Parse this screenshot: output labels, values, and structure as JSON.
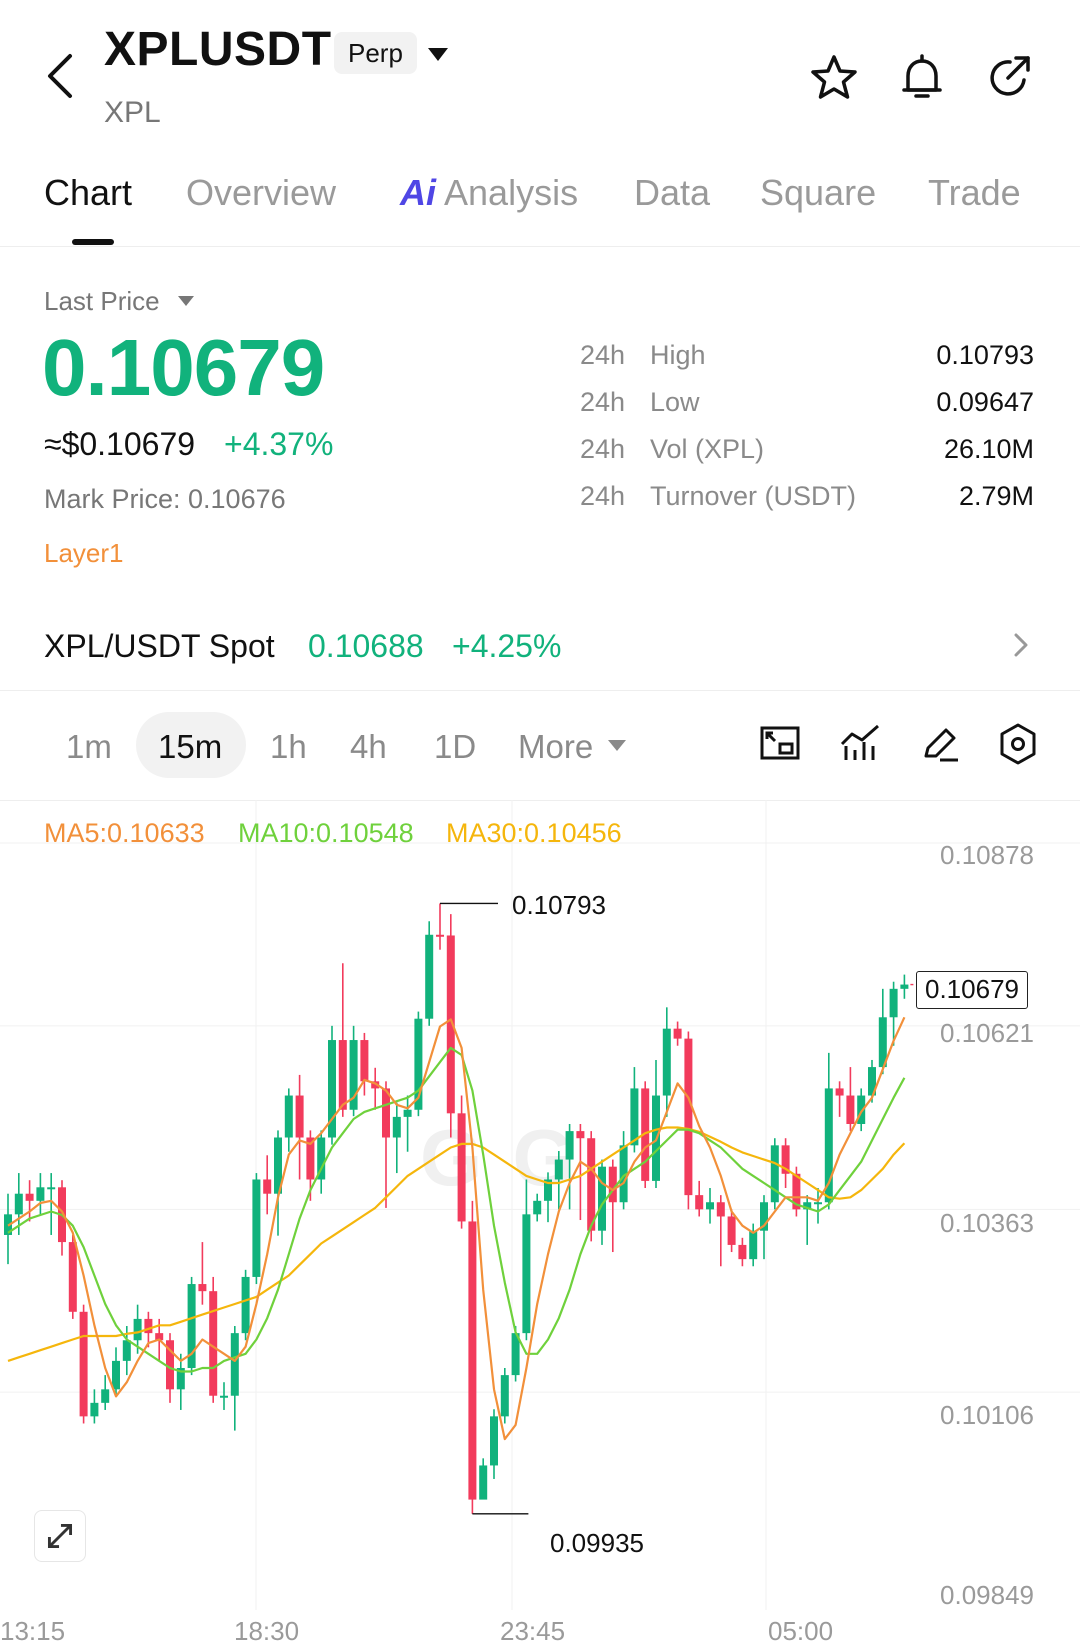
{
  "header": {
    "symbol": "XPLUSDT",
    "contract_type": "Perp",
    "base_asset": "XPL"
  },
  "icons": {
    "back": "chevron-left-icon",
    "favorite": "star-icon",
    "alert": "bell-icon",
    "share": "share-arrow-icon"
  },
  "tabs": [
    {
      "label": "Chart",
      "active": true
    },
    {
      "label": "Overview"
    },
    {
      "label": "Analysis",
      "prefix": "Ai"
    },
    {
      "label": "Data"
    },
    {
      "label": "Square"
    },
    {
      "label": "Trade"
    }
  ],
  "price": {
    "label": "Last Price",
    "last": "0.10679",
    "usd": "≈$0.10679",
    "change": "+4.37%",
    "mark": "Mark Price: 0.10676",
    "tag": "Layer1"
  },
  "stats": [
    {
      "period": "24h",
      "key": "High",
      "value": "0.10793"
    },
    {
      "period": "24h",
      "key": "Low",
      "value": "0.09647"
    },
    {
      "period": "24h",
      "key": "Vol (XPL)",
      "value": "26.10M"
    },
    {
      "period": "24h",
      "key": "Turnover (USDT)",
      "value": "2.79M"
    }
  ],
  "spot": {
    "name": "XPL/USDT Spot",
    "price": "0.10688",
    "change": "+4.25%"
  },
  "intervals": [
    "1m",
    "15m",
    "1h",
    "4h",
    "1D",
    "More"
  ],
  "active_interval": "15m",
  "toolbar_icons": [
    "indicator-frame-icon",
    "indicator-chart-icon",
    "draw-pencil-icon",
    "settings-hexagon-icon"
  ],
  "ma": {
    "ma5": "MA5:0.10633",
    "ma10": "MA10:0.10548",
    "ma30": "MA30:0.10456"
  },
  "colors": {
    "up": "#11b27c",
    "down": "#f23b5c",
    "ma5": "#f2903a",
    "ma10": "#6fd13c",
    "ma30": "#f5b60c",
    "accent_ai": "#4f46e5"
  },
  "chart_data": {
    "type": "candlestick",
    "interval": "15m",
    "y_ticks": [
      "0.10878",
      "0.10621",
      "0.10363",
      "0.10106",
      "0.09849"
    ],
    "x_ticks": [
      "13:15",
      "18:30",
      "23:45",
      "05:00"
    ],
    "last_price_tag": "0.10679",
    "high_marker": "0.10793",
    "low_marker": "0.09935",
    "ylim": [
      0.09849,
      0.10878
    ],
    "candles": [
      [
        0.10327,
        0.10356,
        0.10286,
        0.10385
      ],
      [
        0.10356,
        0.10385,
        0.10327,
        0.10414
      ],
      [
        0.10385,
        0.10375,
        0.10346,
        0.10404
      ],
      [
        0.10375,
        0.10394,
        0.10356,
        0.10414
      ],
      [
        0.10394,
        0.10394,
        0.10327,
        0.10414
      ],
      [
        0.10394,
        0.10317,
        0.10298,
        0.10404
      ],
      [
        0.10317,
        0.10219,
        0.10209,
        0.10327
      ],
      [
        0.10219,
        0.10072,
        0.10062,
        0.10229
      ],
      [
        0.10072,
        0.10091,
        0.10062,
        0.1011
      ],
      [
        0.10091,
        0.1011,
        0.10081,
        0.1013
      ],
      [
        0.1011,
        0.1015,
        0.10101,
        0.10169
      ],
      [
        0.1015,
        0.10179,
        0.1013,
        0.10199
      ],
      [
        0.10179,
        0.10209,
        0.1016,
        0.10229
      ],
      [
        0.10209,
        0.10189,
        0.10169,
        0.10219
      ],
      [
        0.10189,
        0.10179,
        0.1015,
        0.10209
      ],
      [
        0.10179,
        0.1011,
        0.10091,
        0.10189
      ],
      [
        0.1011,
        0.1014,
        0.10081,
        0.1016
      ],
      [
        0.1014,
        0.10258,
        0.1013,
        0.10268
      ],
      [
        0.10258,
        0.10248,
        0.10229,
        0.10317
      ],
      [
        0.10248,
        0.10101,
        0.10091,
        0.10268
      ],
      [
        0.10101,
        0.10101,
        0.10081,
        0.1012
      ],
      [
        0.10101,
        0.10189,
        0.10052,
        0.10199
      ],
      [
        0.10189,
        0.10268,
        0.10179,
        0.10278
      ],
      [
        0.10268,
        0.10405,
        0.10258,
        0.10414
      ],
      [
        0.10405,
        0.10385,
        0.10356,
        0.10439
      ],
      [
        0.10385,
        0.10464,
        0.10326,
        0.10474
      ],
      [
        0.10464,
        0.10523,
        0.10444,
        0.10533
      ],
      [
        0.10523,
        0.10464,
        0.10405,
        0.10552
      ],
      [
        0.10464,
        0.10405,
        0.10375,
        0.10474
      ],
      [
        0.10405,
        0.10464,
        0.10385,
        0.10474
      ],
      [
        0.10464,
        0.10601,
        0.10454,
        0.10621
      ],
      [
        0.10601,
        0.10503,
        0.10493,
        0.10709
      ],
      [
        0.10503,
        0.10601,
        0.10494,
        0.10621
      ],
      [
        0.10601,
        0.10543,
        0.10523,
        0.10611
      ],
      [
        0.10543,
        0.10533,
        0.10503,
        0.10562
      ],
      [
        0.10533,
        0.10464,
        0.10365,
        0.10543
      ],
      [
        0.10464,
        0.10493,
        0.10414,
        0.10513
      ],
      [
        0.10493,
        0.10503,
        0.10444,
        0.10523
      ],
      [
        0.10503,
        0.10631,
        0.10494,
        0.10641
      ],
      [
        0.10631,
        0.10749,
        0.10621,
        0.10768
      ],
      [
        0.10749,
        0.10748,
        0.10728,
        0.10793
      ],
      [
        0.10748,
        0.10498,
        0.10464,
        0.10778
      ],
      [
        0.10498,
        0.10346,
        0.10336,
        0.10523
      ],
      [
        0.10346,
        0.09955,
        0.09935,
        0.10375
      ],
      [
        0.09955,
        0.10003,
        0.09984,
        0.10013
      ],
      [
        0.10003,
        0.10072,
        0.09984,
        0.10082
      ],
      [
        0.10072,
        0.1013,
        0.10062,
        0.1014
      ],
      [
        0.1013,
        0.10189,
        0.10121,
        0.10199
      ],
      [
        0.10189,
        0.10356,
        0.10179,
        0.10405
      ],
      [
        0.10356,
        0.10375,
        0.10346,
        0.10385
      ],
      [
        0.10375,
        0.10405,
        0.10345,
        0.10415
      ],
      [
        0.10405,
        0.10433,
        0.10363,
        0.10445
      ],
      [
        0.10433,
        0.10473,
        0.10363,
        0.10483
      ],
      [
        0.10473,
        0.10463,
        0.10348,
        0.10483
      ],
      [
        0.10463,
        0.10333,
        0.10318,
        0.10473
      ],
      [
        0.10333,
        0.10423,
        0.10313,
        0.10433
      ],
      [
        0.10423,
        0.10373,
        0.10303,
        0.10433
      ],
      [
        0.10373,
        0.10453,
        0.10363,
        0.10473
      ],
      [
        0.10453,
        0.10533,
        0.10443,
        0.10563
      ],
      [
        0.10533,
        0.10403,
        0.10393,
        0.10543
      ],
      [
        0.10403,
        0.10523,
        0.10393,
        0.10573
      ],
      [
        0.10523,
        0.10617,
        0.10493,
        0.10647
      ],
      [
        0.10617,
        0.10603,
        0.10593,
        0.10627
      ],
      [
        0.10603,
        0.10383,
        0.10363,
        0.10613
      ],
      [
        0.10383,
        0.10363,
        0.10353,
        0.10403
      ],
      [
        0.10363,
        0.10373,
        0.10343,
        0.10393
      ],
      [
        0.10373,
        0.10353,
        0.10283,
        0.10383
      ],
      [
        0.10353,
        0.10313,
        0.10303,
        0.10363
      ],
      [
        0.10313,
        0.10293,
        0.10283,
        0.10323
      ],
      [
        0.10293,
        0.10333,
        0.10283,
        0.10343
      ],
      [
        0.10333,
        0.10373,
        0.10293,
        0.10383
      ],
      [
        0.10373,
        0.10453,
        0.10363,
        0.10463
      ],
      [
        0.10453,
        0.10413,
        0.10393,
        0.10463
      ],
      [
        0.10413,
        0.10363,
        0.10353,
        0.10423
      ],
      [
        0.10363,
        0.10373,
        0.10313,
        0.10383
      ],
      [
        0.10373,
        0.10373,
        0.10343,
        0.10393
      ],
      [
        0.10373,
        0.10533,
        0.10363,
        0.10583
      ],
      [
        0.10533,
        0.10523,
        0.10493,
        0.10543
      ],
      [
        0.10523,
        0.10483,
        0.10473,
        0.10563
      ],
      [
        0.10483,
        0.10523,
        0.10473,
        0.10533
      ],
      [
        0.10523,
        0.10563,
        0.10513,
        0.10573
      ],
      [
        0.10563,
        0.10633,
        0.10553,
        0.10673
      ],
      [
        0.10633,
        0.10673,
        0.10593,
        0.10683
      ],
      [
        0.10673,
        0.10679,
        0.10659,
        0.10693
      ]
    ],
    "ma5": [
      0.1034,
      0.1035,
      0.1036,
      0.10372,
      0.10375,
      0.1036,
      0.1033,
      0.1027,
      0.102,
      0.1014,
      0.101,
      0.1012,
      0.1015,
      0.10175,
      0.1018,
      0.10165,
      0.1015,
      0.1016,
      0.1018,
      0.1017,
      0.1016,
      0.1015,
      0.1017,
      0.1023,
      0.103,
      0.1038,
      0.1044,
      0.1046,
      0.10455,
      0.1047,
      0.1049,
      0.1051,
      0.1052,
      0.10545,
      0.1054,
      0.1053,
      0.1051,
      0.10505,
      0.1052,
      0.1057,
      0.1062,
      0.1063,
      0.1059,
      0.1045,
      0.1025,
      0.1011,
      0.1004,
      0.1006,
      0.1014,
      0.1023,
      0.103,
      0.1036,
      0.104,
      0.1043,
      0.1042,
      0.104,
      0.1039,
      0.104,
      0.1043,
      0.1045,
      0.1046,
      0.105,
      0.1054,
      0.1052,
      0.1048,
      0.1045,
      0.1041,
      0.1036,
      0.1034,
      0.1033,
      0.1034,
      0.1036,
      0.1038,
      0.1038,
      0.1038,
      0.10375,
      0.104,
      0.1044,
      0.1047,
      0.105,
      0.1052,
      0.1056,
      0.106,
      0.10633
    ],
    "ma10": [
      0.1033,
      0.1034,
      0.1035,
      0.10355,
      0.1036,
      0.10355,
      0.1034,
      0.1031,
      0.1027,
      0.1023,
      0.102,
      0.1018,
      0.1017,
      0.1016,
      0.1015,
      0.1014,
      0.10135,
      0.10135,
      0.1014,
      0.1014,
      0.1015,
      0.10155,
      0.1016,
      0.1018,
      0.1021,
      0.1025,
      0.103,
      0.1035,
      0.1039,
      0.1042,
      0.1045,
      0.1047,
      0.1049,
      0.105,
      0.10505,
      0.1051,
      0.10515,
      0.1052,
      0.1053,
      0.1055,
      0.1057,
      0.1059,
      0.1058,
      0.1053,
      0.1044,
      0.1034,
      0.1026,
      0.1019,
      0.1016,
      0.1016,
      0.1018,
      0.1021,
      0.1025,
      0.103,
      0.1034,
      0.1037,
      0.1039,
      0.1041,
      0.1042,
      0.1043,
      0.10445,
      0.1046,
      0.10475,
      0.10475,
      0.1047,
      0.1046,
      0.1045,
      0.10435,
      0.1042,
      0.1041,
      0.104,
      0.1039,
      0.1038,
      0.1037,
      0.10365,
      0.1036,
      0.1037,
      0.1039,
      0.1041,
      0.1043,
      0.1046,
      0.1049,
      0.1052,
      0.10548
    ],
    "ma30": [
      0.1015,
      0.10155,
      0.1016,
      0.10165,
      0.1017,
      0.10175,
      0.1018,
      0.10185,
      0.10185,
      0.10185,
      0.10185,
      0.10188,
      0.1019,
      0.10195,
      0.102,
      0.102,
      0.10205,
      0.1021,
      0.10215,
      0.1022,
      0.10225,
      0.1023,
      0.10235,
      0.1024,
      0.1025,
      0.1026,
      0.1027,
      0.10285,
      0.103,
      0.10315,
      0.10325,
      0.10335,
      0.10345,
      0.10355,
      0.10365,
      0.1038,
      0.10395,
      0.1041,
      0.1042,
      0.1043,
      0.1044,
      0.1045,
      0.10455,
      0.10455,
      0.1045,
      0.1044,
      0.1043,
      0.1042,
      0.1041,
      0.10405,
      0.104,
      0.104,
      0.10405,
      0.1041,
      0.1042,
      0.1043,
      0.1044,
      0.1045,
      0.1046,
      0.1047,
      0.10475,
      0.10478,
      0.10478,
      0.10476,
      0.10472,
      0.10465,
      0.10458,
      0.1045,
      0.10443,
      0.10438,
      0.10433,
      0.10428,
      0.1042,
      0.1041,
      0.104,
      0.1039,
      0.1038,
      0.10378,
      0.1038,
      0.1039,
      0.10405,
      0.1042,
      0.1044,
      0.10456
    ]
  }
}
